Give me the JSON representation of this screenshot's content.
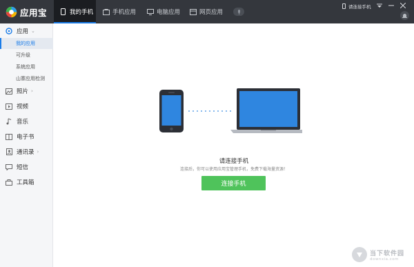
{
  "app": {
    "name": "应用宝"
  },
  "tabs": [
    {
      "label": "我的手机",
      "icon": "phone-icon"
    },
    {
      "label": "手机应用",
      "icon": "app-store-icon"
    },
    {
      "label": "电脑应用",
      "icon": "monitor-icon"
    },
    {
      "label": "网页应用",
      "icon": "web-icon"
    }
  ],
  "header": {
    "connect_status": "请连接手机"
  },
  "sidebar": {
    "items": [
      {
        "label": "应用",
        "icon": "apps-icon"
      },
      {
        "label": "照片",
        "icon": "photo-icon"
      },
      {
        "label": "视频",
        "icon": "video-icon"
      },
      {
        "label": "音乐",
        "icon": "music-icon"
      },
      {
        "label": "电子书",
        "icon": "book-icon"
      },
      {
        "label": "通讯录",
        "icon": "contacts-icon"
      },
      {
        "label": "短信",
        "icon": "sms-icon"
      },
      {
        "label": "工具箱",
        "icon": "toolbox-icon"
      }
    ],
    "subitems": [
      {
        "label": "我的应用"
      },
      {
        "label": "可升级"
      },
      {
        "label": "系统应用"
      },
      {
        "label": "山寨应用检测"
      }
    ]
  },
  "main": {
    "title": "请连接手机",
    "subtitle": "连接后，你可以使用应用宝管理手机，免费下载海量资源！",
    "connect_button": "连接手机"
  },
  "watermark": {
    "title": "当下软件园",
    "url": "downxia.com"
  },
  "colors": {
    "topbar": "#34373d",
    "accent": "#1a7ce8",
    "button_green": "#4fc35b",
    "screen_blue": "#2f86e0"
  }
}
